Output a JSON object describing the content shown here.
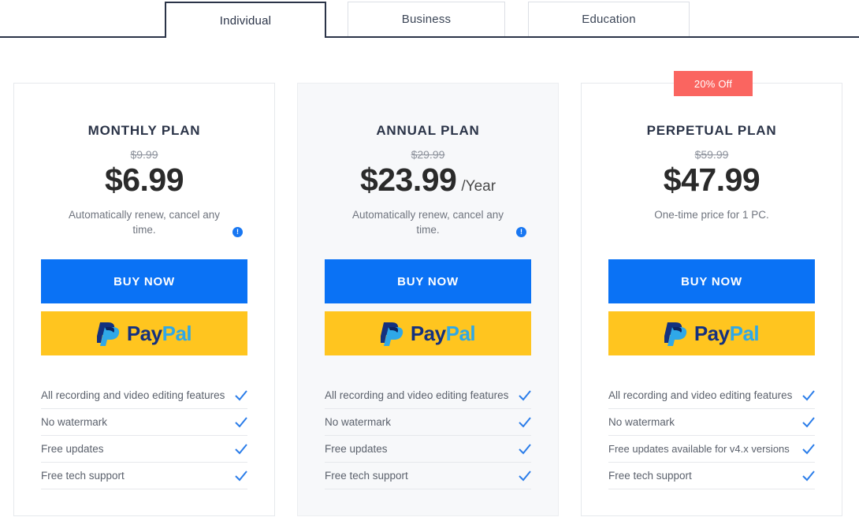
{
  "tabs": [
    {
      "label": "Individual",
      "active": true,
      "name": "tab-individual"
    },
    {
      "label": "Business",
      "active": false,
      "name": "tab-business"
    },
    {
      "label": "Education",
      "active": false,
      "name": "tab-education"
    }
  ],
  "colors": {
    "accent_blue": "#0a72f5",
    "paypal_yellow": "#ffc51f",
    "badge_red": "#fa6560",
    "title_navy": "#2b3448",
    "check_blue": "#2b7de9",
    "card_highlight_bg": "#f7f8fa"
  },
  "buy_label": "BUY NOW",
  "paypal": {
    "pay": "Pay",
    "pal": "Pal",
    "mark": "paypal-p-logo"
  },
  "info_icon_glyph": "!",
  "plans": [
    {
      "title": "MONTHLY PLAN",
      "old_price": "$9.99",
      "price": "$6.99",
      "period": "",
      "note": "Automatically renew, cancel any time.",
      "has_info": true,
      "badge": "",
      "highlighted": false,
      "features": [
        "All recording and video editing features",
        "No watermark",
        "Free updates",
        "Free tech support"
      ]
    },
    {
      "title": "ANNUAL PLAN",
      "old_price": "$29.99",
      "price": "$23.99",
      "period": "/Year",
      "note": "Automatically renew, cancel any time.",
      "has_info": true,
      "badge": "",
      "highlighted": true,
      "features": [
        "All recording and video editing features",
        "No watermark",
        "Free updates",
        "Free tech support"
      ]
    },
    {
      "title": "PERPETUAL PLAN",
      "old_price": "$59.99",
      "price": "$47.99",
      "period": "",
      "note": "One-time price for 1 PC.",
      "has_info": false,
      "badge": "20% Off",
      "highlighted": false,
      "features": [
        "All recording and video editing features",
        "No watermark",
        "Free updates available for v4.x versions",
        "Free tech support"
      ]
    }
  ]
}
